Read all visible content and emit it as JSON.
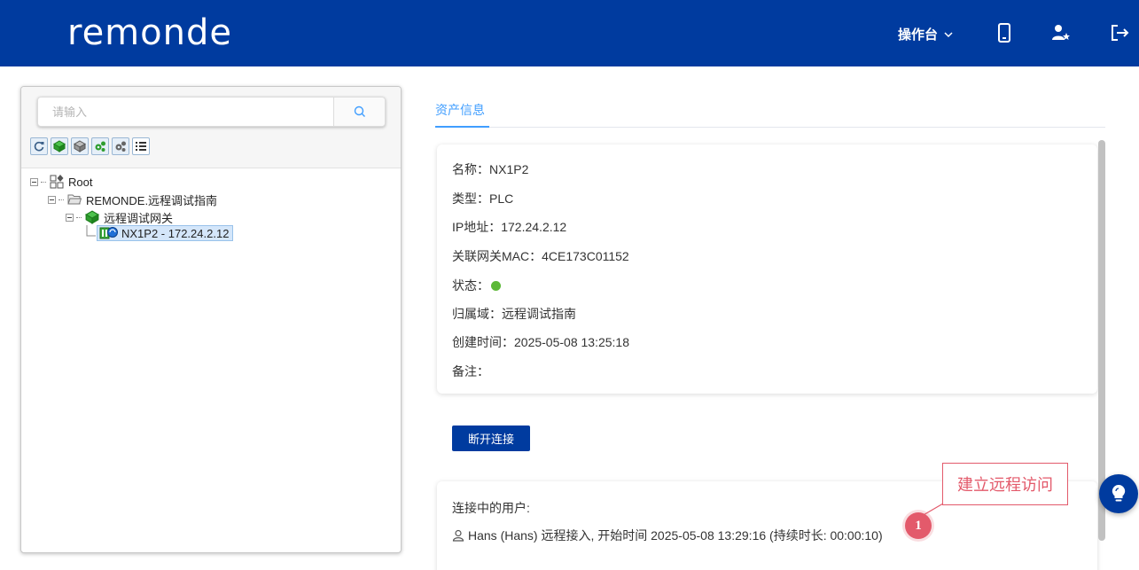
{
  "header": {
    "logo_text": "remonde",
    "console_label": "操作台"
  },
  "search": {
    "placeholder": "请输入"
  },
  "tree": {
    "root": "Root",
    "domain": "REMONDE.远程调试指南",
    "gateway": "远程调试网关",
    "device": "NX1P2 - 172.24.2.12"
  },
  "tabs": {
    "asset_info": "资产信息"
  },
  "asset": {
    "name_label": "名称：",
    "name": "NX1P2",
    "type_label": "类型：",
    "type": "PLC",
    "ip_label": "IP地址：",
    "ip": "172.24.2.12",
    "mac_label": "关联网关MAC：",
    "mac": "4CE173C01152",
    "status_label": "状态：",
    "status_color": "#5cb837",
    "domain_label": "归属域：",
    "domain": "远程调试指南",
    "created_label": "创建时间：",
    "created": "2025-05-08 13:25:18",
    "remark_label": "备注：",
    "remark": ""
  },
  "actions": {
    "disconnect": "断开连接"
  },
  "connection": {
    "title": "连接中的用户:",
    "user_line": "Hans (Hans) 远程接入, 开始时间 2025-05-08 13:29:16 (持续时长: 00:00:10)"
  },
  "annotation": {
    "callout": "建立远程访问",
    "marker": "1",
    "color": "#e35a6b"
  },
  "colors": {
    "brand": "#003b9f",
    "accent": "#409eff"
  }
}
